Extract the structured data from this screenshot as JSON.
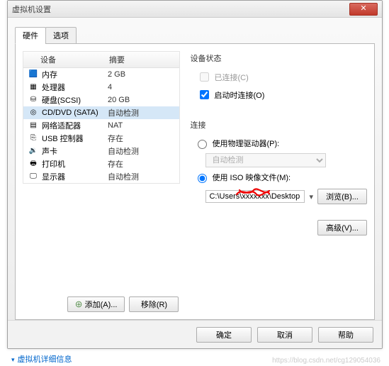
{
  "window": {
    "title": "虚拟机设置",
    "close_glyph": "✕"
  },
  "tabs": {
    "hardware": "硬件",
    "options": "选项"
  },
  "hwtable": {
    "col_device": "设备",
    "col_summary": "摘要",
    "rows": [
      {
        "icon": "🟦",
        "icon_name": "memory-icon",
        "device": "内存",
        "summary": "2 GB",
        "selected": false
      },
      {
        "icon": "▦",
        "icon_name": "cpu-icon",
        "device": "处理器",
        "summary": "4",
        "selected": false
      },
      {
        "icon": "⛁",
        "icon_name": "hdd-icon",
        "device": "硬盘(SCSI)",
        "summary": "20 GB",
        "selected": false
      },
      {
        "icon": "◎",
        "icon_name": "cd-icon",
        "device": "CD/DVD (SATA)",
        "summary": "自动检测",
        "selected": true
      },
      {
        "icon": "▤",
        "icon_name": "nic-icon",
        "device": "网络适配器",
        "summary": "NAT",
        "selected": false
      },
      {
        "icon": "⎘",
        "icon_name": "usb-icon",
        "device": "USB 控制器",
        "summary": "存在",
        "selected": false
      },
      {
        "icon": "🔉",
        "icon_name": "sound-icon",
        "device": "声卡",
        "summary": "自动检测",
        "selected": false
      },
      {
        "icon": "🖶",
        "icon_name": "printer-icon",
        "device": "打印机",
        "summary": "存在",
        "selected": false
      },
      {
        "icon": "🖵",
        "icon_name": "display-icon",
        "device": "显示器",
        "summary": "自动检测",
        "selected": false
      }
    ]
  },
  "hw_buttons": {
    "add": "添加(A)...",
    "remove": "移除(R)"
  },
  "status": {
    "title": "设备状态",
    "connected": {
      "label": "已连接(C)",
      "checked": false,
      "enabled": false
    },
    "connect_on": {
      "label": "启动时连接(O)",
      "checked": true,
      "enabled": true
    }
  },
  "connection": {
    "title": "连接",
    "phys": {
      "label": "使用物理驱动器(P):",
      "selected": false,
      "dropdown_value": "自动检测"
    },
    "iso": {
      "label": "使用 ISO 映像文件(M):",
      "selected": true,
      "path": "C:\\Users\\xxxxxxx\\Desktop",
      "browse": "浏览(B)..."
    },
    "advanced": "高级(V)..."
  },
  "dialog_buttons": {
    "ok": "确定",
    "cancel": "取消",
    "help": "帮助"
  },
  "footer": {
    "link": "虚拟机详细信息"
  },
  "watermark": "https://blog.csdn.net/cg129054036"
}
